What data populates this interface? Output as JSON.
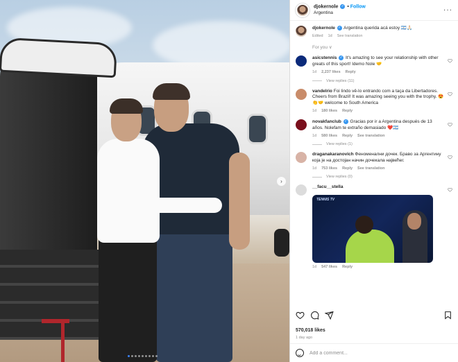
{
  "post": {
    "username": "djokernole",
    "follow_label": "Follow",
    "location": "Argentina",
    "more_label": "···",
    "carousel_count": 9,
    "carousel_active": 0,
    "next_label": "›"
  },
  "caption": {
    "username": "djokernole",
    "text": "Argentina querida acá estoy 🇦🇷🙏🏻",
    "edited": "Edited",
    "time": "1d",
    "translate": "See translation"
  },
  "for_you": "For you ∨",
  "comments": [
    {
      "username": "asicstennis",
      "verified": true,
      "avatar_color": "#0b2a7a",
      "text": "It's amazing to see your relationship with other greats of this sport! Idemo Nole 🤝",
      "time": "1d",
      "likes": "2,237 likes",
      "reply": "Reply",
      "translate": "",
      "view_replies": "View replies (11)"
    },
    {
      "username": "vandelrio",
      "verified": false,
      "avatar_color": "#c98c6a",
      "text": "Foi lindo vê-lo entrando com a taça da Libertadores. Cheers from Brazil! It was amazing seeing you with the trophy. 😍👏🤝 welcome to South America",
      "time": "1d",
      "likes": "180 likes",
      "reply": "Reply",
      "translate": "",
      "view_replies": ""
    },
    {
      "username": "novakfanclub",
      "verified": true,
      "avatar_color": "#7a0f1c",
      "text": "Gracias por ir a Argentina después de 13 años. Nolefam te extraño demasiado ❤️🇦🇷",
      "time": "1d",
      "likes": "580 likes",
      "reply": "Reply",
      "translate": "See translation",
      "view_replies": "View replies (1)"
    },
    {
      "username": "draganakaranovich",
      "verified": false,
      "avatar_color": "#d8b3a6",
      "text": "Феноменални дочек. Браво за Аргентину која је на достојан начин дочекала највећег.",
      "time": "1d",
      "likes": "753 likes",
      "reply": "Reply",
      "translate": "See translation",
      "view_replies": "View replies (0)"
    },
    {
      "username": "__facu__stella",
      "verified": false,
      "avatar_color": "#dcdcdc",
      "text": "",
      "gif_label": "TENNIS TV",
      "time": "1d",
      "likes": "547 likes",
      "reply": "Reply",
      "translate": "",
      "view_replies": ""
    }
  ],
  "footer": {
    "likes": "570,018 likes",
    "ago": "1 day ago",
    "comment_placeholder": "Add a comment..."
  },
  "icons": [
    "heart-icon",
    "comment-icon",
    "share-icon",
    "bookmark-icon",
    "emoji-icon",
    "more-icon",
    "verified-icon"
  ]
}
